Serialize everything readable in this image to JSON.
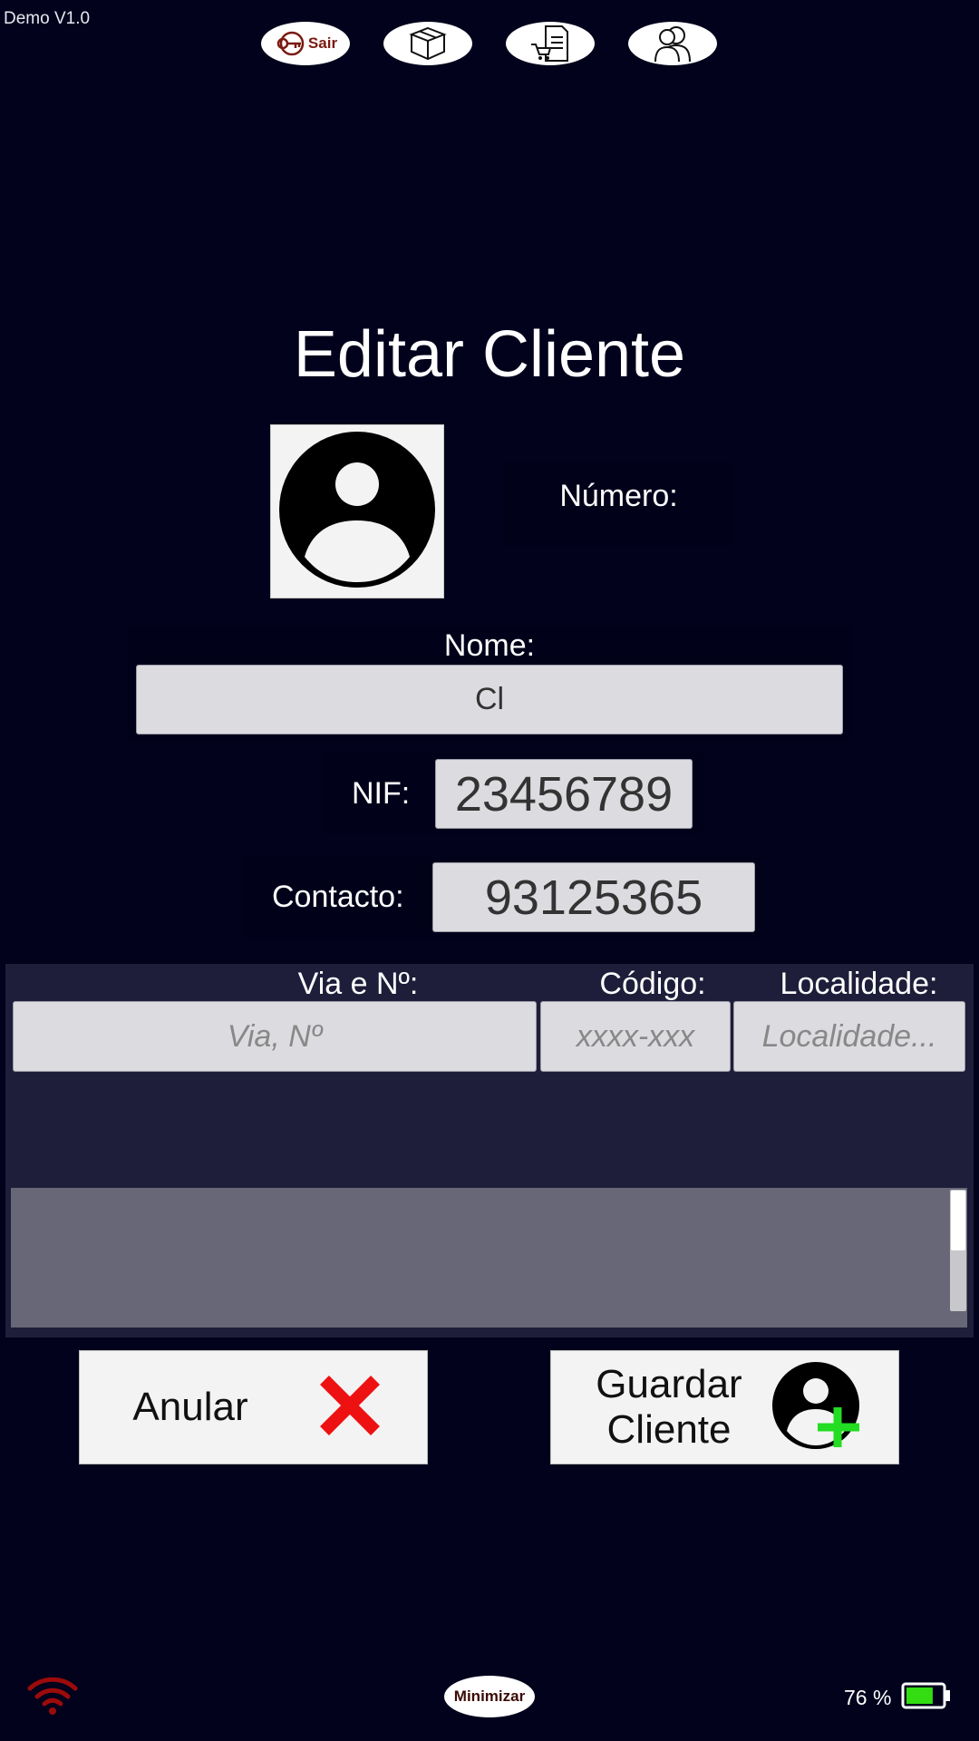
{
  "app": {
    "version": "Demo V1.0"
  },
  "toolbar": {
    "exit_label": "Sair",
    "items": [
      {
        "icon": "key-icon"
      },
      {
        "icon": "box-icon"
      },
      {
        "icon": "cart-document-icon"
      },
      {
        "icon": "users-icon"
      }
    ]
  },
  "form": {
    "title": "Editar Cliente",
    "numero_label": "Número:",
    "nome_label": "Nome:",
    "nome_value": "Cl",
    "nif_label": "NIF:",
    "nif_value": "23456789",
    "contacto_label": "Contacto:",
    "contacto_value": "93125365"
  },
  "address": {
    "via_label": "Via e Nº:",
    "via_placeholder": "Via, Nº",
    "codigo_label": "Código:",
    "codigo_placeholder": "xxxx-xxx",
    "localidade_label": "Localidade:",
    "localidade_placeholder": "Localidade..."
  },
  "actions": {
    "cancel_label": "Anular",
    "save_label_line1": "Guardar",
    "save_label_line2": "Cliente"
  },
  "status": {
    "minimize_label": "Minimizar",
    "battery_text": "76 %",
    "battery_level": 0.76,
    "wifi_color": "#9c0b0b",
    "battery_fill_color": "#33dd11"
  }
}
